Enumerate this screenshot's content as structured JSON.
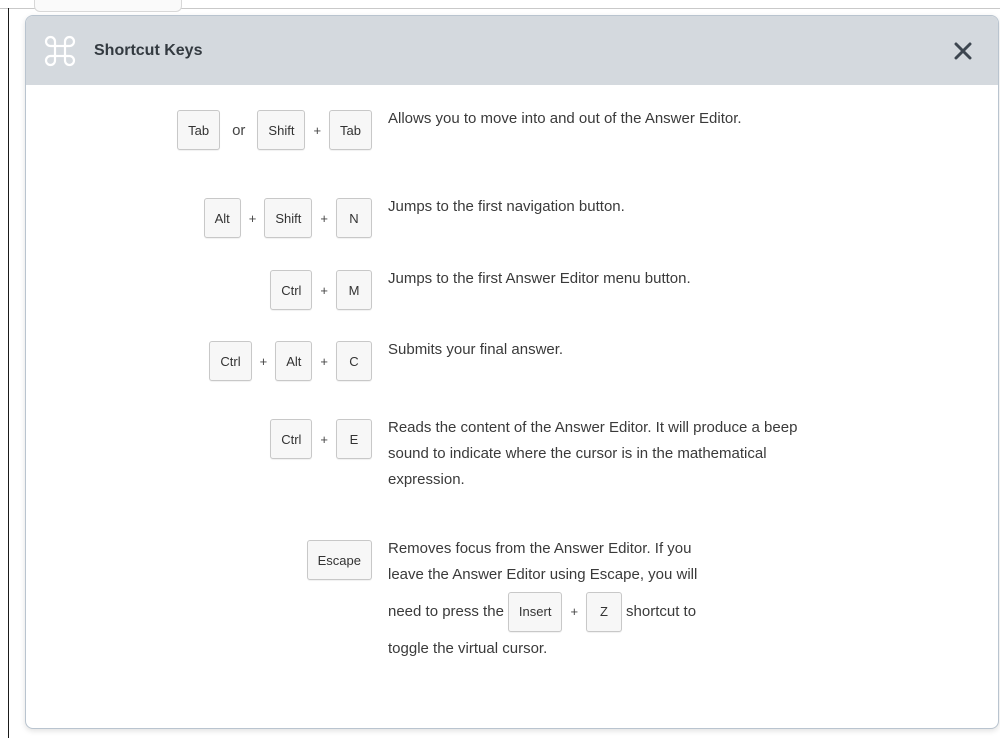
{
  "dialog": {
    "title": "Shortcut Keys",
    "icon": "command-icon",
    "close_icon": "close-icon"
  },
  "shortcuts": [
    {
      "keys": [
        "Tab",
        "or",
        "Shift",
        "+",
        "Tab"
      ],
      "description": "Allows you to move into and out of the Answer Editor."
    },
    {
      "keys": [
        "Alt",
        "+",
        "Shift",
        "+",
        "N"
      ],
      "description": "Jumps to the first navigation button."
    },
    {
      "keys": [
        "Ctrl",
        "+",
        "M"
      ],
      "description": "Jumps to the first Answer Editor menu button."
    },
    {
      "keys": [
        "Ctrl",
        "+",
        "Alt",
        "+",
        "C"
      ],
      "description": "Submits your final answer."
    },
    {
      "keys": [
        "Ctrl",
        "+",
        "E"
      ],
      "description": "Reads the content of the Answer Editor. It will produce a beep sound to indicate where the cursor is in the mathematical expression."
    },
    {
      "keys": [
        "Escape"
      ],
      "description_parts": {
        "line1": "Removes focus from the Answer Editor. If you",
        "line2": "leave the Answer Editor using Escape, you will",
        "line3_before": "need to press the",
        "inline_key1": "Insert",
        "inline_plus": "+",
        "inline_key2": "Z",
        "line3_after": "shortcut to",
        "line4": "toggle the virtual cursor."
      }
    }
  ],
  "colors": {
    "header_bg": "#d4d9de",
    "key_bg": "#f7f7f7",
    "text": "#3a3a3a"
  }
}
